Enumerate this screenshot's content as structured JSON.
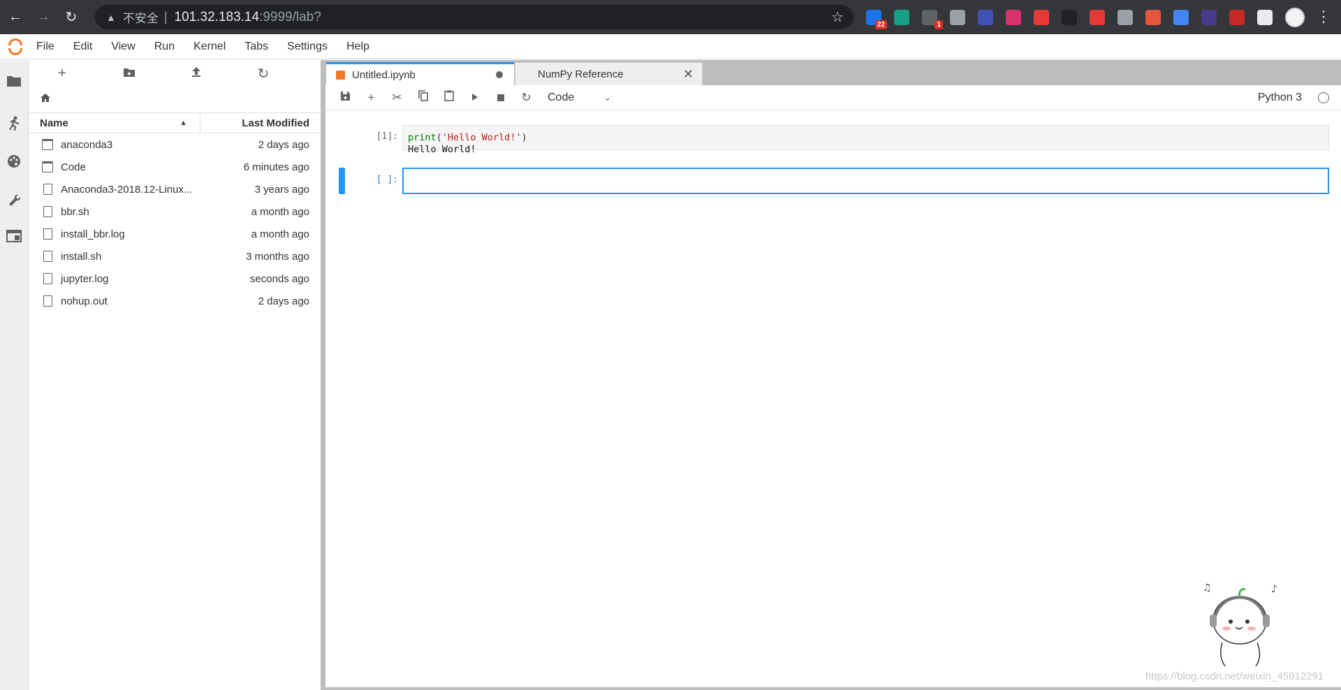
{
  "browser": {
    "address_warning": "不安全",
    "url_host": "101.32.183.14",
    "url_path": ":9999/lab?",
    "extensions": [
      {
        "icon": "puzzle-grid-extension-icon",
        "color": "#1a73e8",
        "badge": "22"
      },
      {
        "icon": "s-extension-icon",
        "color": "#16a085",
        "badge": ""
      },
      {
        "icon": "glasses-extension-icon",
        "color": "#5f6368",
        "badge": "1"
      },
      {
        "icon": "triangle-extension-icon",
        "color": "#9aa0a6",
        "badge": ""
      },
      {
        "icon": "moon-extension-icon",
        "color": "#3f51b5",
        "badge": ""
      },
      {
        "icon": "du-extension-icon",
        "color": "#d6336c",
        "badge": ""
      },
      {
        "icon": "refresh-red-extension-icon",
        "color": "#e53935",
        "badge": ""
      },
      {
        "icon": "jb-extension-icon",
        "color": "#202124",
        "badge": ""
      },
      {
        "icon": "abp-extension-icon",
        "color": "#e53935",
        "badge": ""
      },
      {
        "icon": "shield-extension-icon",
        "color": "#9aa0a6",
        "badge": ""
      },
      {
        "icon": "org-extension-icon",
        "color": "#e8553e",
        "badge": ""
      },
      {
        "icon": "translate-extension-icon",
        "color": "#4285f4",
        "badge": ""
      },
      {
        "icon": "ia-extension-icon",
        "color": "#4a3a8c",
        "badge": ""
      },
      {
        "icon": "circle-extension-icon",
        "color": "#c62828",
        "badge": ""
      },
      {
        "icon": "puzzle-extension-icon",
        "color": "#e8eaed",
        "badge": ""
      }
    ]
  },
  "menubar": [
    "File",
    "Edit",
    "View",
    "Run",
    "Kernel",
    "Tabs",
    "Settings",
    "Help"
  ],
  "filebrowser": {
    "header_name": "Name",
    "header_modified": "Last Modified",
    "files": [
      {
        "name": "anaconda3",
        "type": "folder",
        "modified": "2 days ago"
      },
      {
        "name": "Code",
        "type": "folder",
        "modified": "6 minutes ago"
      },
      {
        "name": "Anaconda3-2018.12-Linux...",
        "type": "file",
        "modified": "3 years ago"
      },
      {
        "name": "bbr.sh",
        "type": "file",
        "modified": "a month ago"
      },
      {
        "name": "install_bbr.log",
        "type": "file",
        "modified": "a month ago"
      },
      {
        "name": "install.sh",
        "type": "file",
        "modified": "3 months ago"
      },
      {
        "name": "jupyter.log",
        "type": "file",
        "modified": "seconds ago"
      },
      {
        "name": "nohup.out",
        "type": "file",
        "modified": "2 days ago"
      }
    ]
  },
  "tabs": {
    "active_label": "Untitled.ipynb",
    "inactive_label": "NumPy Reference"
  },
  "notebook": {
    "cell_type": "Code",
    "kernel": "Python 3",
    "cell1_prompt": "[1]:",
    "code_fn": "print",
    "code_open": "(",
    "code_str": "'Hello World!'",
    "code_close": ")",
    "output": "Hello World!",
    "cell2_prompt": "[ ]:"
  },
  "watermark": "https://blog.csdn.net/weixin_45912291",
  "colors": {
    "accent": "#2196f3",
    "brand": "#f37726"
  }
}
